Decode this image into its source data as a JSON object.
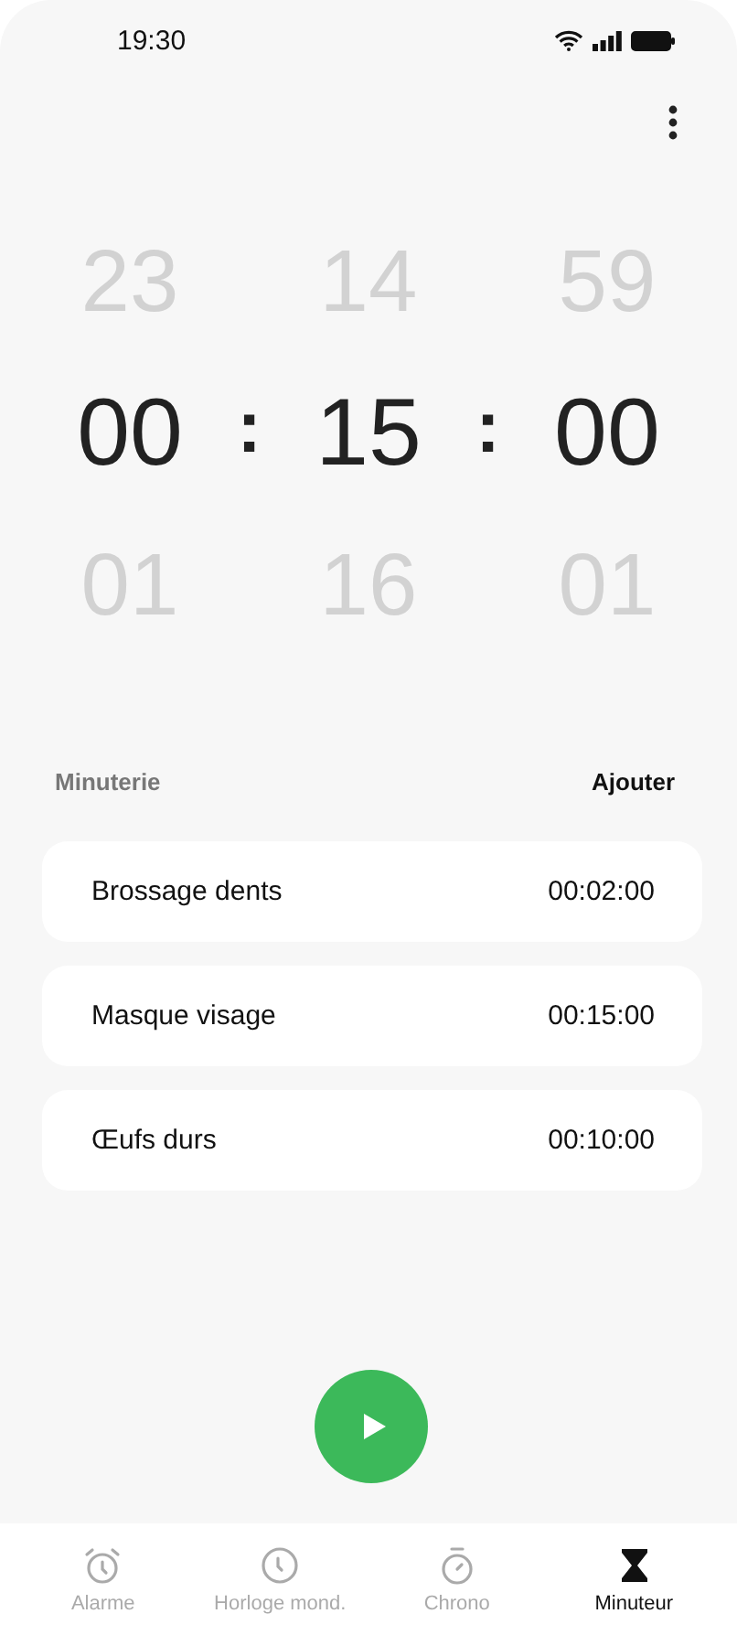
{
  "status_bar": {
    "time": "19:30"
  },
  "picker": [
    {
      "kind": "column",
      "above": "23",
      "value": "00",
      "below": "01"
    },
    {
      "kind": "separator",
      "text": ":"
    },
    {
      "kind": "column",
      "above": "14",
      "value": "15",
      "below": "16"
    },
    {
      "kind": "separator",
      "text": ":"
    },
    {
      "kind": "column",
      "above": "59",
      "value": "00",
      "below": "01"
    }
  ],
  "section": {
    "title": "Minuterie",
    "action": "Ajouter"
  },
  "presets": [
    {
      "name": "Brossage dents",
      "duration": "00:02:00"
    },
    {
      "name": "Masque visage",
      "duration": "00:15:00"
    },
    {
      "name": "Œufs durs",
      "duration": "00:10:00"
    }
  ],
  "tabs": [
    {
      "kind": "alarm",
      "label": "Alarme",
      "selected": false
    },
    {
      "kind": "clock",
      "label": "Horloge mond.",
      "selected": false
    },
    {
      "kind": "stopwatch",
      "label": "Chrono",
      "selected": false
    },
    {
      "kind": "hourglass",
      "label": "Minuteur",
      "selected": true
    }
  ]
}
